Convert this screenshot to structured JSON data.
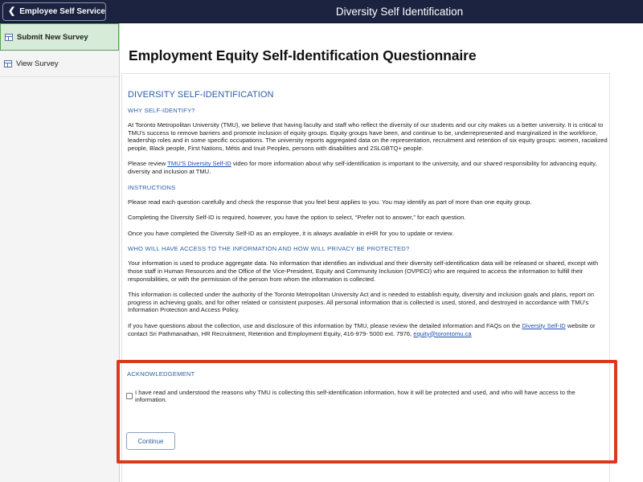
{
  "header": {
    "back_label": "Employee Self Service",
    "title": "Diversity Self Identification"
  },
  "sidebar": {
    "items": [
      {
        "label": "Submit New Survey",
        "icon": "survey-form-icon",
        "active": true
      },
      {
        "label": "View Survey",
        "icon": "survey-form-icon",
        "active": false
      }
    ]
  },
  "main": {
    "page_title": "Employment Equity Self-Identification Questionnaire",
    "section_title": "DIVERSITY SELF-IDENTIFICATION",
    "why_heading": "WHY SELF-IDENTIFY?",
    "why_para": "At Toronto Metropolitan University (TMU), we believe that having faculty and staff who reflect the diversity of our students and our city makes us a better university. It is critical to TMU's success to remove barriers and promote inclusion of equity groups. Equity groups have been, and continue to be, underrepresented and marginalized in the workforce, leadership roles and in some specific occupations. The university reports aggregated data on the representation, recruitment and retention of six equity groups: women, racialized people, Black people, First Nations, Métis and Inuit Peoples, persons with disabilities and 2SLGBTQ+ people.",
    "review_pre": "Please review ",
    "review_link": "TMU'S Diversity Self-ID",
    "review_post": " video for more information about why self-identification is important to the university, and our shared responsibility for advancing equity, diversity and inclusion at TMU.",
    "instructions_heading": "INSTRUCTIONS",
    "instructions_1": "Please read each question carefully and check the response that you feel best applies to you. You may identify as part of more than one equity group.",
    "instructions_2": "Completing the Diversity Self-ID is required, however, you have the option to select, “Prefer not to answer,” for each question.",
    "instructions_3": "Once you have completed the Diversity Self-ID as an employee, it is always available in eHR for you to update or review.",
    "privacy_heading": "WHO WILL HAVE ACCESS TO THE INFORMATION AND HOW WILL PRIVACY BE PROTECTED?",
    "privacy_1": "Your information is used to produce aggregate data.  No information that identifies an individual and their diversity self-identification data will be released or shared, except with those staff in Human Resources and the Office of the Vice-President, Equity and Community Inclusion (OVPECI) who are required to access the information to fulfill their responsibilities, or with the permission of the person from whom the information is collected.",
    "privacy_2": "This information is collected under the authority of the Toronto Metropolitan University Act and is needed to establish equity, diversity and inclusion goals and plans, report on progress in achieving goals, and for other related or consistent purposes. All personal information that is collected is used, stored, and destroyed in accordance with TMU's Information Protection and Access Policy.",
    "questions_pre": "If you have questions about the collection, use and disclosure of this information by TMU, please review the detailed information and FAQs on the ",
    "questions_link": "Diversity Self-ID",
    "questions_mid": " website or contact Sri Pathmanathan, HR Recruitment, Retention and Employment Equity, 416-979- 5000 ext. 7976, ",
    "questions_email": "equity@torontomu.ca",
    "ack_heading": "ACKNOWLEDGEMENT",
    "ack_text": "I have read and understood the reasons why TMU is collecting this self-identification information, how it will be protected and used, and who will have access to the information.",
    "ack_checked": false,
    "continue_label": "Continue"
  },
  "colors": {
    "topbar": "#1b2340",
    "link_blue": "#2b5da8",
    "active_green": "#d6ecd8",
    "highlight_red": "#d9391e"
  }
}
